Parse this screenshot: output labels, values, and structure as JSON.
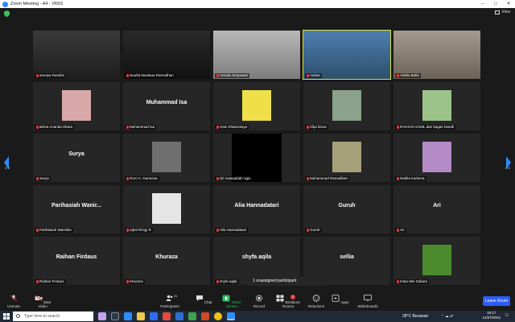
{
  "window": {
    "title": "Zoom Meeting - A4 - VR03"
  },
  "view": {
    "label": "View"
  },
  "pagination": {
    "left": "2/2",
    "right": "2/2"
  },
  "participants": [
    {
      "display": "ameiya Randini",
      "bigname": "",
      "video": true
    },
    {
      "display": "Naufal Maulana Ramadhan",
      "bigname": "",
      "video": true
    },
    {
      "display": "Aninda Setyawati",
      "bigname": "",
      "video": true
    },
    {
      "display": "Adrian",
      "bigname": "",
      "video": true
    },
    {
      "display": "Adelia Bella",
      "bigname": "",
      "video": true
    },
    {
      "display": "Belva Ananda Shara",
      "bigname": "",
      "photo": true
    },
    {
      "display": "Muhammad Isa",
      "bigname": "Muhammad Isa"
    },
    {
      "display": "Hani Khairunisya",
      "bigname": "",
      "photo": true
    },
    {
      "display": "rifqa lizara",
      "bigname": "",
      "photo": true
    },
    {
      "display": "RAIHAN HADIL dan bagas hanafi",
      "bigname": "",
      "photo": true
    },
    {
      "display": "Surya",
      "bigname": "Surya"
    },
    {
      "display": "Roro A. Ganeesa",
      "bigname": "",
      "photo": true
    },
    {
      "display": "siti mawaddah ngiu",
      "bigname": "",
      "photo": true
    },
    {
      "display": "Muhammad Ramadhan",
      "bigname": "",
      "photo": true
    },
    {
      "display": "Nabila Karisma",
      "bigname": "",
      "photo": true
    },
    {
      "display": "Parihasiah Wanirike",
      "bigname": "Parihasiah Wanir..."
    },
    {
      "display": "Iqbal Rizqy R",
      "bigname": "",
      "photo": true
    },
    {
      "display": "Alia Hannadatari",
      "bigname": "Alia Hannadatari"
    },
    {
      "display": "Guruh",
      "bigname": "Guruh"
    },
    {
      "display": "Ari",
      "bigname": "Ari"
    },
    {
      "display": "Raihan Firdaus",
      "bigname": "Raihan Firdaus"
    },
    {
      "display": "Khuraza",
      "bigname": "Khuraza"
    },
    {
      "display": "shyfa aqila",
      "bigname": "shyfa aqila"
    },
    {
      "display": "",
      "bigname": "sellia"
    },
    {
      "display": "Intan Mei Zahara",
      "bigname": "",
      "photo": true
    }
  ],
  "unassigned": "1 unassigned participant",
  "toolbar": {
    "unmute": "Unmute",
    "start_video": "Start Video",
    "participants": "Participants",
    "participants_count": "31",
    "chat": "Chat",
    "share_screen": "Share Screen",
    "record": "Record",
    "breakout_rooms": "Breakout Rooms",
    "breakout_badge": "1",
    "reactions": "Reactions",
    "apps": "Apps",
    "whiteboards": "Whiteboards",
    "leave": "Leave Room"
  },
  "taskbar": {
    "search_placeholder": "Type here to search",
    "weather": "28°C  Berawan",
    "time": "19:17",
    "date": "12/07/2022"
  },
  "colors": {
    "accent": "#2d5cf6",
    "active_speaker": "#d6e23a",
    "muted": "#e03a3a"
  }
}
